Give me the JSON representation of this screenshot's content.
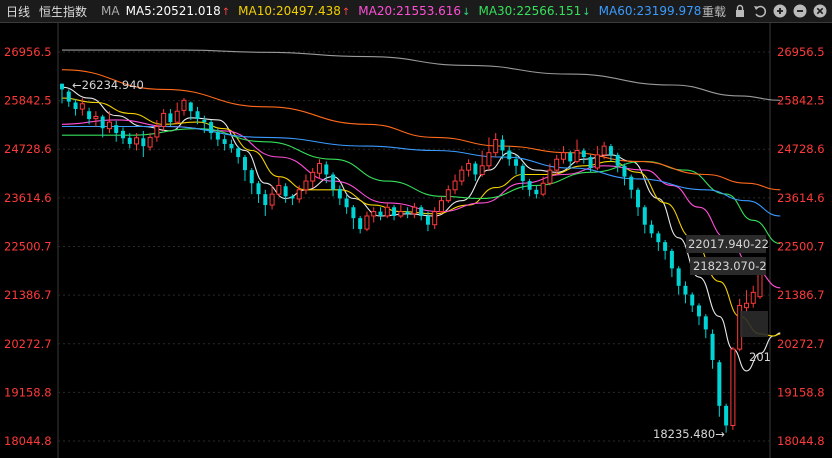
{
  "toolbar": {
    "period": "日线",
    "index_name": "恒生指数",
    "ma_label": "MA",
    "ma_items": [
      {
        "text": "MA5:20521.018",
        "arrow": "↑",
        "color": "#ffffff",
        "arrow_color": "#ff4444"
      },
      {
        "text": "MA10:20497.438",
        "arrow": "↑",
        "color": "#f2d000",
        "arrow_color": "#ff4444"
      },
      {
        "text": "MA20:21553.616",
        "arrow": "↓",
        "color": "#ff4fd8",
        "arrow_color": "#2fd47a"
      },
      {
        "text": "MA30:22566.151",
        "arrow": "↓",
        "color": "#36e05a",
        "arrow_color": "#2fd47a"
      },
      {
        "text": "MA60:23199.978",
        "arrow": "",
        "color": "#3b9bff",
        "arrow_color": "#3b9bff"
      }
    ],
    "reset_label": "重载",
    "icons": [
      "lock-icon",
      "undo-icon",
      "zoom-in-icon",
      "zoom-out-icon",
      "close-icon"
    ]
  },
  "chart_data": {
    "type": "candlestick",
    "y_ticks": [
      "26956.5",
      "25842.5",
      "24728.6",
      "23614.6",
      "22500.7",
      "21386.7",
      "20272.7",
      "19158.8",
      "18044.8"
    ],
    "ylim": [
      18044.8,
      26956.5
    ],
    "colors": {
      "up": "#ff3a3a",
      "down": "#00d4d4",
      "axis_text": "#ff3a3a",
      "grid": "#2a2a2a"
    },
    "annotations": {
      "high": "←26234.940",
      "low": "18235.480→",
      "line1": "22017.940-22",
      "line2": "21823.070-2",
      "ma_tail": "201"
    },
    "candles": [
      [
        26230,
        26100,
        26234.9,
        25780
      ],
      [
        26050,
        25820,
        26100,
        25700
      ],
      [
        25800,
        25650,
        25880,
        25500
      ],
      [
        25650,
        25770,
        25900,
        25500
      ],
      [
        25600,
        25420,
        25680,
        25300
      ],
      [
        25430,
        25480,
        25600,
        25250
      ],
      [
        25480,
        25210,
        25520,
        25000
      ],
      [
        25200,
        25350,
        25600,
        25100
      ],
      [
        25280,
        25100,
        25380,
        24900
      ],
      [
        25150,
        24980,
        25230,
        24850
      ],
      [
        24990,
        24850,
        25100,
        24750
      ],
      [
        24850,
        24990,
        25100,
        24700
      ],
      [
        24980,
        24800,
        25150,
        24550
      ],
      [
        24780,
        25000,
        25100,
        24700
      ],
      [
        25010,
        25250,
        25400,
        24900
      ],
      [
        25250,
        25550,
        25650,
        25150
      ],
      [
        25550,
        25350,
        25650,
        25250
      ],
      [
        25350,
        25600,
        25800,
        25300
      ],
      [
        25620,
        25850,
        25900,
        25500
      ],
      [
        25800,
        25600,
        25820,
        25400
      ],
      [
        25600,
        25420,
        25700,
        25300
      ],
      [
        25400,
        25350,
        25500,
        25100
      ],
      [
        25350,
        25100,
        25400,
        24950
      ],
      [
        25120,
        24950,
        25200,
        24800
      ],
      [
        24960,
        24850,
        25050,
        24700
      ],
      [
        24850,
        24750,
        24950,
        24650
      ],
      [
        24750,
        24550,
        24800,
        24400
      ],
      [
        24550,
        24250,
        24600,
        24000
      ],
      [
        24250,
        23950,
        24300,
        23700
      ],
      [
        23950,
        23700,
        24000,
        23500
      ],
      [
        23700,
        23450,
        23800,
        23200
      ],
      [
        23450,
        23700,
        23900,
        23350
      ],
      [
        23700,
        23900,
        24100,
        23650
      ],
      [
        23880,
        23650,
        23950,
        23500
      ],
      [
        23650,
        23600,
        23700,
        23450
      ],
      [
        23590,
        23800,
        23900,
        23500
      ],
      [
        23800,
        24000,
        24150,
        23700
      ],
      [
        24000,
        24200,
        24300,
        23850
      ],
      [
        24180,
        24400,
        24500,
        24050
      ],
      [
        24380,
        24150,
        24450,
        23950
      ],
      [
        24150,
        23800,
        24200,
        23650
      ],
      [
        23820,
        23600,
        23900,
        23450
      ],
      [
        23600,
        23400,
        23680,
        23250
      ],
      [
        23400,
        23150,
        23450,
        22900
      ],
      [
        23150,
        22900,
        23200,
        22800
      ],
      [
        22900,
        23200,
        23300,
        22850
      ],
      [
        23200,
        23300,
        23400,
        23050
      ],
      [
        23300,
        23200,
        23400,
        23100
      ],
      [
        23200,
        23400,
        23500,
        23150
      ],
      [
        23400,
        23200,
        23450,
        23100
      ],
      [
        23200,
        23300,
        23450,
        23150
      ],
      [
        23300,
        23250,
        23400,
        23150
      ],
      [
        23250,
        23400,
        23500,
        23150
      ],
      [
        23400,
        23200,
        23450,
        23100
      ],
      [
        23200,
        23000,
        23300,
        22850
      ],
      [
        23000,
        23300,
        23400,
        22900
      ],
      [
        23300,
        23550,
        23650,
        23250
      ],
      [
        23550,
        23800,
        23900,
        23500
      ],
      [
        23800,
        24000,
        24150,
        23700
      ],
      [
        24000,
        24250,
        24350,
        23900
      ],
      [
        24250,
        24400,
        24500,
        24100
      ],
      [
        24400,
        24150,
        24450,
        24000
      ],
      [
        24150,
        24350,
        24700,
        24100
      ],
      [
        24350,
        24650,
        25000,
        24250
      ],
      [
        24650,
        24950,
        25100,
        24550
      ],
      [
        24950,
        24700,
        25050,
        24500
      ],
      [
        24700,
        24500,
        24800,
        24350
      ],
      [
        24500,
        24350,
        24600,
        24150
      ],
      [
        24350,
        24000,
        24400,
        23800
      ],
      [
        24000,
        23800,
        24050,
        23650
      ],
      [
        23800,
        23700,
        23900,
        23600
      ],
      [
        23700,
        23950,
        24100,
        23650
      ],
      [
        23950,
        24250,
        24400,
        23900
      ],
      [
        24250,
        24500,
        24600,
        24150
      ],
      [
        24500,
        24650,
        24800,
        24400
      ],
      [
        24650,
        24450,
        24700,
        24300
      ],
      [
        24450,
        24700,
        24950,
        24400
      ],
      [
        24700,
        24550,
        24750,
        24400
      ],
      [
        24550,
        24300,
        24600,
        24200
      ],
      [
        24300,
        24600,
        24800,
        24250
      ],
      [
        24600,
        24800,
        24900,
        24500
      ],
      [
        24800,
        24600,
        24850,
        24450
      ],
      [
        24600,
        24350,
        24650,
        24200
      ],
      [
        24350,
        24100,
        24400,
        23900
      ],
      [
        24100,
        23800,
        24150,
        23600
      ],
      [
        23800,
        23400,
        23850,
        23200
      ],
      [
        23400,
        23000,
        23450,
        22800
      ],
      [
        23000,
        22800,
        23100,
        22700
      ],
      [
        22800,
        22600,
        22850,
        22400
      ],
      [
        22600,
        22400,
        22650,
        22200
      ],
      [
        22400,
        22000,
        22450,
        21800
      ],
      [
        22000,
        21600,
        22050,
        21400
      ],
      [
        21600,
        21400,
        21700,
        21200
      ],
      [
        21400,
        21150,
        21450,
        21000
      ],
      [
        21150,
        20900,
        21200,
        20700
      ],
      [
        20900,
        20600,
        20950,
        20400
      ],
      [
        20500,
        19900,
        20600,
        19700
      ],
      [
        19850,
        18850,
        19900,
        18600
      ],
      [
        18850,
        18400,
        18900,
        18235.5
      ],
      [
        18400,
        20150,
        20200,
        18300
      ],
      [
        20150,
        21150,
        21300,
        20100
      ],
      [
        21100,
        21200,
        21500,
        21000
      ],
      [
        21200,
        21450,
        21600,
        21100
      ],
      [
        21350,
        21900,
        21950,
        21300
      ]
    ],
    "ma_series": [
      {
        "name": "MA5",
        "color": "#e8e8e8",
        "points": [
          [
            0,
            26150
          ],
          [
            4,
            25900
          ],
          [
            8,
            25500
          ],
          [
            12,
            25250
          ],
          [
            16,
            25150
          ],
          [
            19,
            25450
          ],
          [
            23,
            25400
          ],
          [
            27,
            24700
          ],
          [
            30,
            23950
          ],
          [
            33,
            23600
          ],
          [
            36,
            23800
          ],
          [
            40,
            24100
          ],
          [
            43,
            23600
          ],
          [
            47,
            23200
          ],
          [
            51,
            23250
          ],
          [
            55,
            23200
          ],
          [
            59,
            23550
          ],
          [
            63,
            24250
          ],
          [
            66,
            24650
          ],
          [
            70,
            24250
          ],
          [
            73,
            24200
          ],
          [
            77,
            24500
          ],
          [
            81,
            24600
          ],
          [
            84,
            24450
          ],
          [
            88,
            23600
          ],
          [
            91,
            22700
          ],
          [
            94,
            21800
          ],
          [
            97,
            20900
          ],
          [
            99,
            20150
          ],
          [
            101,
            19650
          ],
          [
            103,
            20050
          ],
          [
            105,
            20450
          ],
          [
            106,
            20521
          ]
        ]
      },
      {
        "name": "MA10",
        "color": "#f2d000",
        "points": [
          [
            0,
            25900
          ],
          [
            5,
            25800
          ],
          [
            10,
            25550
          ],
          [
            15,
            25300
          ],
          [
            20,
            25350
          ],
          [
            24,
            25200
          ],
          [
            28,
            24700
          ],
          [
            32,
            24100
          ],
          [
            36,
            23800
          ],
          [
            41,
            23800
          ],
          [
            46,
            23450
          ],
          [
            50,
            23300
          ],
          [
            55,
            23250
          ],
          [
            60,
            23450
          ],
          [
            64,
            23850
          ],
          [
            68,
            24150
          ],
          [
            72,
            24150
          ],
          [
            77,
            24350
          ],
          [
            81,
            24450
          ],
          [
            85,
            24200
          ],
          [
            89,
            23500
          ],
          [
            93,
            22700
          ],
          [
            97,
            21700
          ],
          [
            100,
            20900
          ],
          [
            103,
            20500
          ],
          [
            105,
            20450
          ],
          [
            106,
            20497
          ]
        ]
      },
      {
        "name": "MA20",
        "color": "#ff4fd8",
        "points": [
          [
            0,
            25300
          ],
          [
            8,
            25400
          ],
          [
            16,
            25250
          ],
          [
            24,
            25150
          ],
          [
            32,
            24550
          ],
          [
            40,
            24000
          ],
          [
            48,
            23500
          ],
          [
            56,
            23300
          ],
          [
            62,
            23500
          ],
          [
            68,
            23950
          ],
          [
            74,
            24150
          ],
          [
            80,
            24350
          ],
          [
            86,
            24250
          ],
          [
            90,
            23900
          ],
          [
            94,
            23400
          ],
          [
            98,
            22700
          ],
          [
            102,
            22000
          ],
          [
            106,
            21554
          ]
        ]
      },
      {
        "name": "MA30",
        "color": "#36e05a",
        "points": [
          [
            0,
            25050
          ],
          [
            10,
            25050
          ],
          [
            20,
            25200
          ],
          [
            30,
            24900
          ],
          [
            40,
            24500
          ],
          [
            48,
            24000
          ],
          [
            56,
            23650
          ],
          [
            62,
            23600
          ],
          [
            70,
            23900
          ],
          [
            78,
            24200
          ],
          [
            86,
            24450
          ],
          [
            92,
            24250
          ],
          [
            98,
            23700
          ],
          [
            102,
            23100
          ],
          [
            106,
            22566
          ]
        ]
      },
      {
        "name": "MA60",
        "color": "#3b9bff",
        "points": [
          [
            0,
            25250
          ],
          [
            15,
            25250
          ],
          [
            30,
            25000
          ],
          [
            45,
            24800
          ],
          [
            55,
            24700
          ],
          [
            65,
            24550
          ],
          [
            75,
            24300
          ],
          [
            85,
            24050
          ],
          [
            95,
            23800
          ],
          [
            101,
            23550
          ],
          [
            106,
            23200
          ]
        ]
      },
      {
        "name": "MA120",
        "color": "#ff6a1a",
        "points": [
          [
            0,
            26550
          ],
          [
            15,
            26100
          ],
          [
            30,
            25700
          ],
          [
            45,
            25300
          ],
          [
            55,
            25000
          ],
          [
            65,
            24800
          ],
          [
            75,
            24650
          ],
          [
            85,
            24450
          ],
          [
            95,
            24150
          ],
          [
            101,
            23950
          ],
          [
            106,
            23800
          ]
        ]
      },
      {
        "name": "MA250",
        "color": "#9a9a9a",
        "points": [
          [
            0,
            27000
          ],
          [
            18,
            27000
          ],
          [
            30,
            26950
          ],
          [
            45,
            26850
          ],
          [
            60,
            26650
          ],
          [
            75,
            26450
          ],
          [
            90,
            26200
          ],
          [
            100,
            25950
          ],
          [
            106,
            25850
          ]
        ]
      }
    ]
  }
}
